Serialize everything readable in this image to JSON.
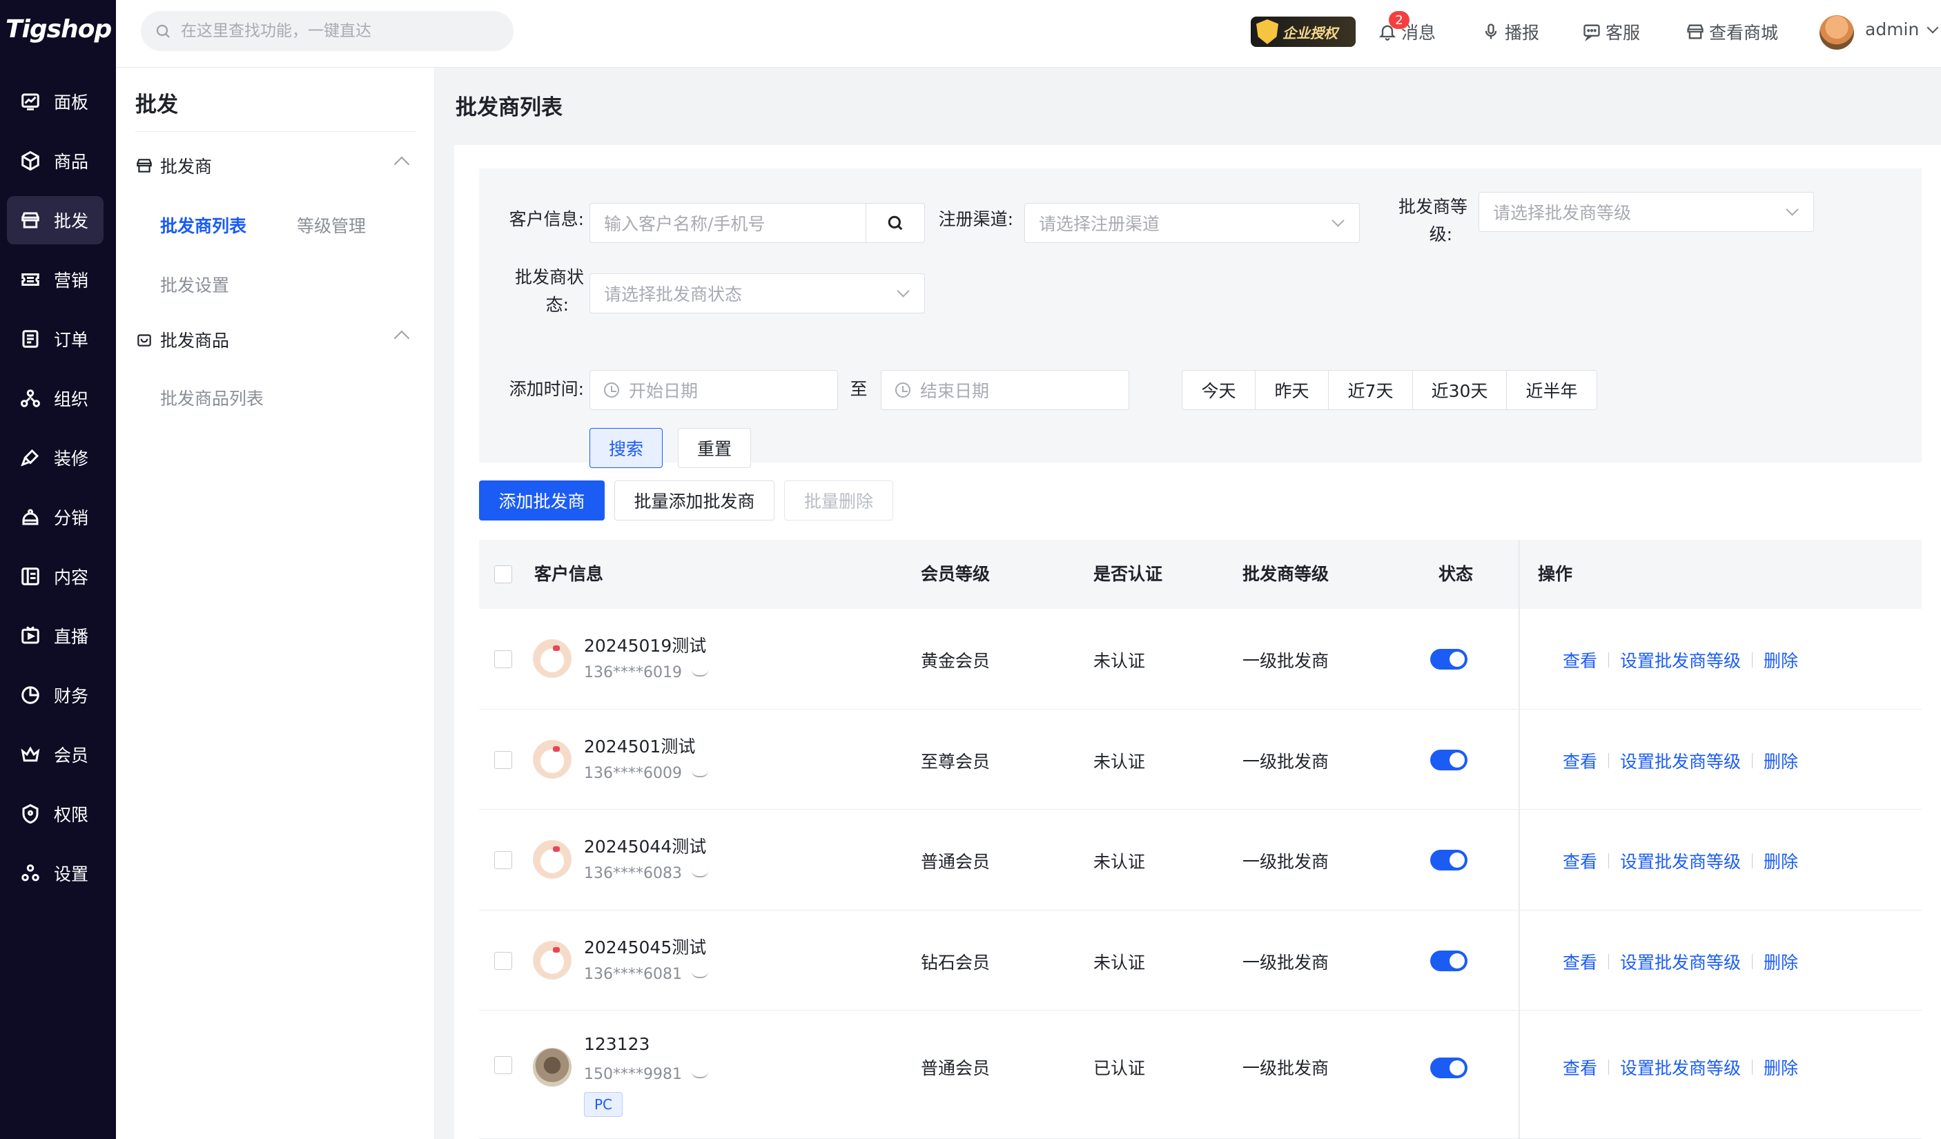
{
  "app": {
    "logo": "Tigshop"
  },
  "rail": {
    "items": [
      {
        "label": "面板",
        "icon": "chart-icon"
      },
      {
        "label": "商品",
        "icon": "box-icon"
      },
      {
        "label": "批发",
        "icon": "store-icon",
        "active": true
      },
      {
        "label": "营销",
        "icon": "coupon-icon"
      },
      {
        "label": "订单",
        "icon": "order-icon"
      },
      {
        "label": "组织",
        "icon": "org-icon"
      },
      {
        "label": "装修",
        "icon": "brush-icon"
      },
      {
        "label": "分销",
        "icon": "share-icon"
      },
      {
        "label": "内容",
        "icon": "content-icon"
      },
      {
        "label": "直播",
        "icon": "live-icon"
      },
      {
        "label": "财务",
        "icon": "finance-icon"
      },
      {
        "label": "会员",
        "icon": "crown-icon"
      },
      {
        "label": "权限",
        "icon": "shield-icon"
      },
      {
        "label": "设置",
        "icon": "settings-icon"
      }
    ]
  },
  "header": {
    "search_placeholder": "在这里查找功能，一键直达",
    "enterprise_badge": "企业授权",
    "notify_count": "2",
    "messages": "消息",
    "broadcast": "播报",
    "service": "客服",
    "view_store": "查看商城",
    "user": "admin"
  },
  "subnav": {
    "title": "批发",
    "group1": "批发商",
    "item_list": "批发商列表",
    "item_levels": "等级管理",
    "item_settings": "批发设置",
    "group2": "批发商品",
    "item_goods": "批发商品列表"
  },
  "page": {
    "title": "批发商列表"
  },
  "filters": {
    "customer_label": "客户信息:",
    "customer_placeholder": "输入客户名称/手机号",
    "channel_label": "注册渠道:",
    "channel_placeholder": "请选择注册渠道",
    "level_label_1": "批发商等",
    "level_label_2": "级:",
    "level_placeholder": "请选择批发商等级",
    "status_label_1": "批发商状",
    "status_label_2": "态:",
    "status_placeholder": "请选择批发商状态",
    "time_label": "添加时间:",
    "start_placeholder": "开始日期",
    "to": "至",
    "end_placeholder": "结束日期",
    "quick": [
      "今天",
      "昨天",
      "近7天",
      "近30天",
      "近半年"
    ],
    "search_btn": "搜索",
    "reset_btn": "重置"
  },
  "actions": {
    "add": "添加批发商",
    "batch_add": "批量添加批发商",
    "batch_delete": "批量删除"
  },
  "table": {
    "headers": {
      "customer": "客户信息",
      "member_level": "会员等级",
      "verified": "是否认证",
      "wholesale_level": "批发商等级",
      "status": "状态",
      "ops": "操作"
    },
    "rows": [
      {
        "name": "20245019测试",
        "phone": "136****6019",
        "member_level": "黄金会员",
        "verified": "未认证",
        "wholesale_level": "一级批发商",
        "status_on": true
      },
      {
        "name": "2024501测试",
        "phone": "136****6009",
        "member_level": "至尊会员",
        "verified": "未认证",
        "wholesale_level": "一级批发商",
        "status_on": true
      },
      {
        "name": "20245044测试",
        "phone": "136****6083",
        "member_level": "普通会员",
        "verified": "未认证",
        "wholesale_level": "一级批发商",
        "status_on": true
      },
      {
        "name": "20245045测试",
        "phone": "136****6081",
        "member_level": "钻石会员",
        "verified": "未认证",
        "wholesale_level": "一级批发商",
        "status_on": true
      },
      {
        "name": "123123",
        "phone": "150****9981",
        "tag": "PC",
        "member_level": "普通会员",
        "verified": "已认证",
        "wholesale_level": "一级批发商",
        "status_on": true
      }
    ],
    "op_view": "查看",
    "op_set_level": "设置批发商等级",
    "op_delete": "删除"
  }
}
